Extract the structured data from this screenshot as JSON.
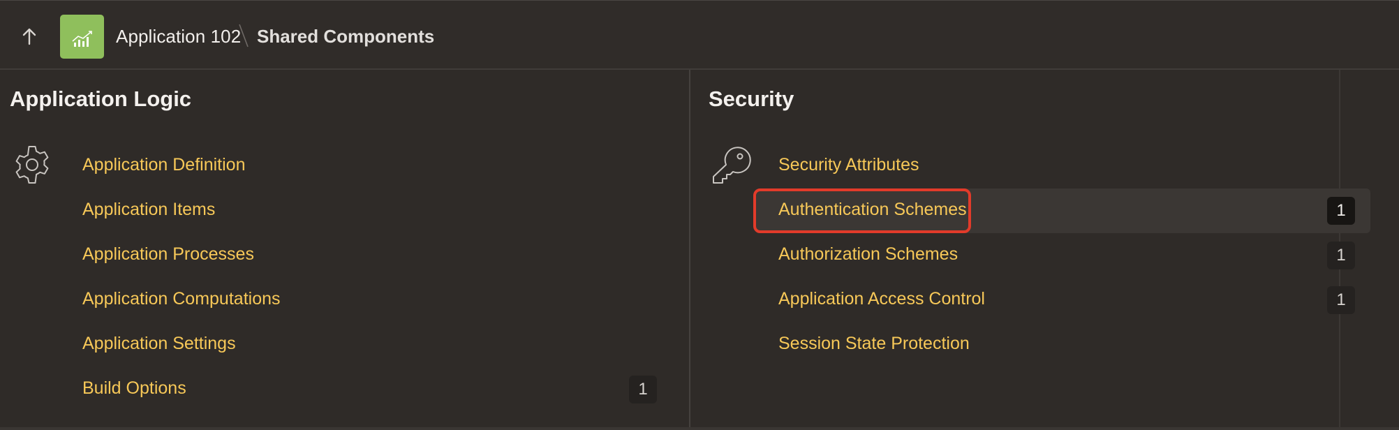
{
  "header": {
    "up_icon": "arrow-up-icon",
    "app_icon": "bar-chart-icon",
    "app_icon_color": "#8fbf5c",
    "app_name": "Application 102",
    "current_page": "Shared Components"
  },
  "application_logic": {
    "title": "Application Logic",
    "icon": "gear-icon",
    "items": [
      {
        "label": "Application Definition",
        "count": null
      },
      {
        "label": "Application Items",
        "count": null
      },
      {
        "label": "Application Processes",
        "count": null
      },
      {
        "label": "Application Computations",
        "count": null
      },
      {
        "label": "Application Settings",
        "count": null
      },
      {
        "label": "Build Options",
        "count": "1"
      }
    ]
  },
  "security": {
    "title": "Security",
    "icon": "key-icon",
    "items": [
      {
        "label": "Security Attributes",
        "count": null
      },
      {
        "label": "Authentication Schemes",
        "count": "1",
        "highlighted": true
      },
      {
        "label": "Authorization Schemes",
        "count": "1"
      },
      {
        "label": "Application Access Control",
        "count": "1"
      },
      {
        "label": "Session State Protection",
        "count": null
      }
    ]
  },
  "colors": {
    "background": "#2f2b28",
    "link": "#f7c858",
    "highlight_border": "#e23b2a"
  }
}
